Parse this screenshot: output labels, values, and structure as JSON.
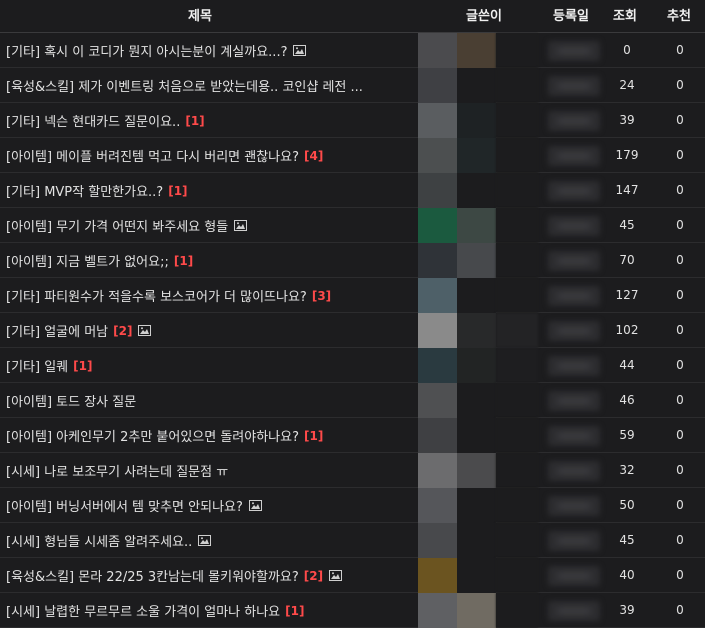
{
  "header": {
    "title": "제목",
    "author": "글쓴이",
    "date": "등록일",
    "views": "조회",
    "likes": "추천"
  },
  "colors": {
    "comment_count": "#ff4a4a",
    "background": "#1c1c1e"
  },
  "rows": [
    {
      "title": "[기타] 혹시 이 코디가 뭔지 아시는분이 계실까요...?",
      "comments": "",
      "has_image": true,
      "views": "0",
      "likes": "0",
      "av": [
        "#4b4b4e",
        "#4a3f33",
        "#1c1c1e"
      ]
    },
    {
      "title": "[육성&스킬] 제가 이벤트링 처음으로 받았는데용.. 코인샵 레전 ...",
      "comments": "",
      "has_image": false,
      "views": "24",
      "likes": "0",
      "av": [
        "#3f4044",
        "#1c1c1e",
        "#1c1c1e"
      ]
    },
    {
      "title": "[기타] 넥슨 현대카드 질문이요..",
      "comments": "[1]",
      "has_image": false,
      "views": "39",
      "likes": "0",
      "av": [
        "#5a5d60",
        "#1e2224",
        "#1c1c1e"
      ]
    },
    {
      "title": "[아이템] 메이플 버려진템 먹고 다시 버리면 괜찮나요?",
      "comments": "[4]",
      "has_image": false,
      "views": "179",
      "likes": "0",
      "av": [
        "#4c4f50",
        "#202628",
        "#1c1c1e"
      ]
    },
    {
      "title": "[기타] MVP작 할만한가요..?",
      "comments": "[1]",
      "has_image": false,
      "views": "147",
      "likes": "0",
      "av": [
        "#3e4143",
        "#1c1c1e",
        "#1c1c1e"
      ]
    },
    {
      "title": "[아이템] 무기 가격 어떤지 봐주세요 형들",
      "comments": "",
      "has_image": true,
      "views": "45",
      "likes": "0",
      "av": [
        "#1b5a3f",
        "#3d4844",
        "#1c1c1e"
      ]
    },
    {
      "title": "[아이템] 지금 벨트가 없어요;;",
      "comments": "[1]",
      "has_image": false,
      "views": "70",
      "likes": "0",
      "av": [
        "#2f3338",
        "#47494c",
        "#1c1c1e"
      ]
    },
    {
      "title": "[기타] 파티원수가 적을수록 보스코어가 더 많이뜨나요?",
      "comments": "[3]",
      "has_image": false,
      "views": "127",
      "likes": "0",
      "av": [
        "#4e6068",
        "#1c1c1e",
        "#1c1c1e"
      ]
    },
    {
      "title": "[기타] 얼굴에 머남",
      "comments": "[2]",
      "has_image": true,
      "views": "102",
      "likes": "0",
      "av": [
        "#8a8a8a",
        "#28292a",
        "#232325"
      ]
    },
    {
      "title": "[기타] 일퀘",
      "comments": "[1]",
      "has_image": false,
      "views": "44",
      "likes": "0",
      "av": [
        "#2a3a40",
        "#222424",
        "#1e1e20"
      ]
    },
    {
      "title": "[아이템] 토드 장사 질문",
      "comments": "",
      "has_image": false,
      "views": "46",
      "likes": "0",
      "av": [
        "#4f5052",
        "#1c1c1e",
        "#1c1c1e"
      ]
    },
    {
      "title": "[아이템] 아케인무기 2추만 붙어있으면 돌려야하나요?",
      "comments": "[1]",
      "has_image": false,
      "views": "59",
      "likes": "0",
      "av": [
        "#3f4043",
        "#1c1c1e",
        "#1c1c1e"
      ]
    },
    {
      "title": "[시세] 나로 보조무기 사려는데 질문점 ㅠ",
      "comments": "",
      "has_image": false,
      "views": "32",
      "likes": "0",
      "av": [
        "#6c6c6e",
        "#4b4b4d",
        "#1c1c1e"
      ]
    },
    {
      "title": "[아이템] 버닝서버에서 템 맞추면 안되나요?",
      "comments": "",
      "has_image": true,
      "views": "50",
      "likes": "0",
      "av": [
        "#55565a",
        "#1c1c1e",
        "#1c1c1e"
      ]
    },
    {
      "title": "[시세] 형님들 시세좀 알려주세요..",
      "comments": "",
      "has_image": true,
      "views": "45",
      "likes": "0",
      "av": [
        "#48494c",
        "#1c1c1e",
        "#1c1c1e"
      ]
    },
    {
      "title": "[육성&스킬] 몬라 22/25 3칸남는데 몰키워야할까요?",
      "comments": "[2]",
      "has_image": true,
      "views": "40",
      "likes": "0",
      "av": [
        "#6b5420",
        "#1c1c1e",
        "#1c1c1e"
      ]
    },
    {
      "title": "[시세] 날렵한 무르무르 소울 가격이 얼마나 하나요",
      "comments": "[1]",
      "has_image": false,
      "views": "39",
      "likes": "0",
      "av": [
        "#5f6063",
        "#706b62",
        "#1c1c1e"
      ]
    }
  ]
}
